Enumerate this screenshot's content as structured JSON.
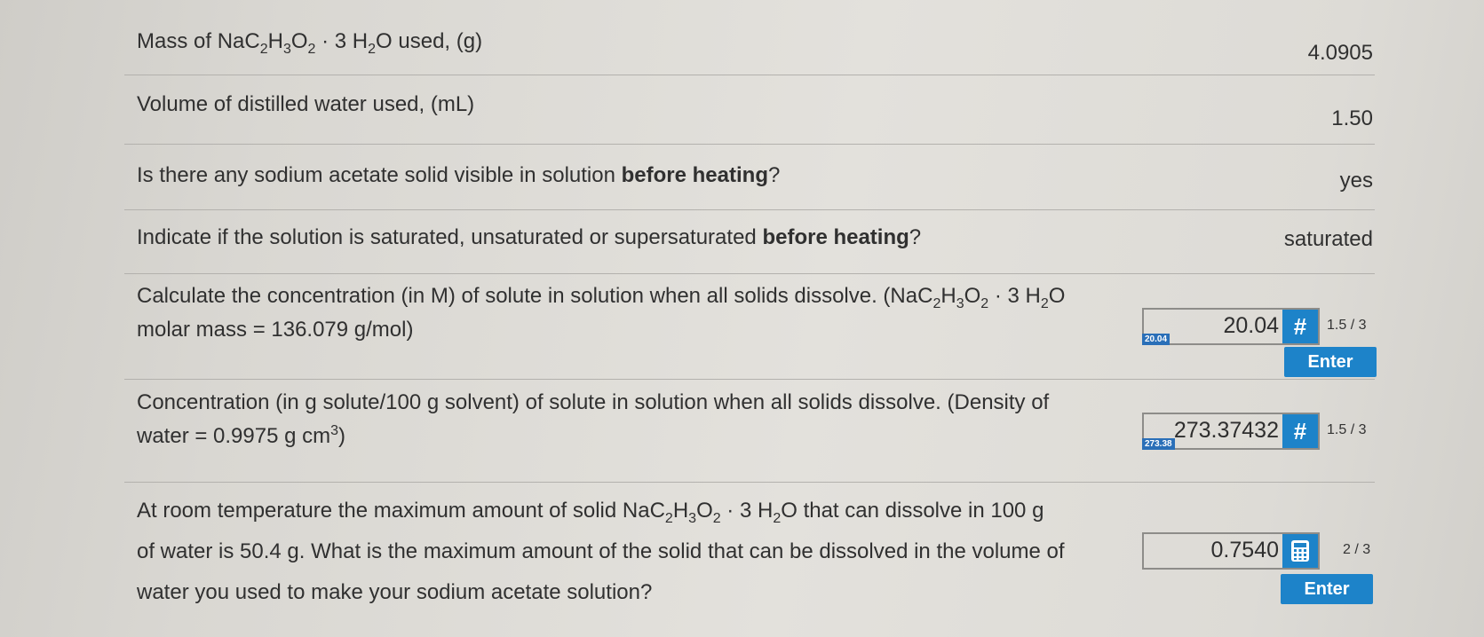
{
  "rows": [
    {
      "question_parts": [
        "Mass of NaC",
        "2",
        "H",
        "3",
        "O",
        "2",
        " · 3 H",
        "2",
        "O used, (g)"
      ],
      "answer": "4.0905"
    },
    {
      "question": "Volume of distilled water used, (mL)",
      "answer": "1.50"
    },
    {
      "question_pre": "Is there any sodium acetate solid visible in solution ",
      "question_bold": "before heating",
      "question_post": "?",
      "answer": "yes"
    },
    {
      "question_pre": "Indicate if the solution is saturated, unsaturated or supersaturated ",
      "question_bold": "before heating",
      "question_post": "?",
      "answer": "saturated"
    },
    {
      "line1_parts": [
        "Calculate the concentration (in M) of solute in solution when all solids dissolve. (NaC",
        "2",
        "H",
        "3",
        "O",
        "2",
        " · 3 H",
        "2",
        "O"
      ],
      "line2": "molar mass = 136.079 g/mol)",
      "input_value": "20.04",
      "input_tag": "20.04",
      "score": "1.5 / 3",
      "enter_label": "Enter"
    },
    {
      "line1": "Concentration (in g solute/100 g solvent) of solute in solution when all solids dissolve. (Density of",
      "line2_pre": "water = 0.9975 g cm",
      "line2_sup": "3",
      "line2_post": ")",
      "input_value": "273.37432",
      "input_tag": "273.38",
      "score": "1.5 / 3"
    },
    {
      "line1_parts": [
        "At room temperature the maximum amount of solid NaC",
        "2",
        "H",
        "3",
        "O",
        "2",
        " · 3 H",
        "2",
        "O that can dissolve in 100 g"
      ],
      "line2": "of water is 50.4 g. What is the maximum amount of the solid that can be dissolved in the volume of",
      "line3": "water you used to make your sodium acetate solution?",
      "input_value": "0.7540",
      "score": "2 / 3",
      "enter_label": "Enter"
    }
  ],
  "hash_symbol": "#",
  "colors": {
    "accent": "#1d83c9",
    "tag": "#2a6fb8",
    "text": "#303030",
    "divider": "#b3b1ad"
  },
  "icons": {
    "hash": "hash-icon",
    "calculator": "calculator-icon"
  }
}
